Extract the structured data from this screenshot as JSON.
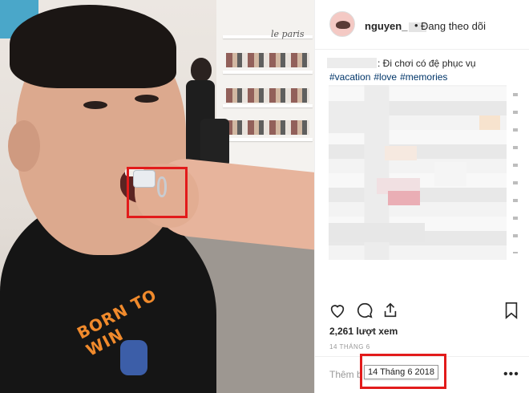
{
  "post": {
    "username": "nguyen_",
    "separator": "•",
    "follow_label": "Đang theo dõi",
    "caption_text": ": Đi chơi có đệ phục vụ",
    "hashtags": [
      "#vacation",
      "#love",
      "#memories"
    ],
    "views": "2,261 lượt xem",
    "date_small": "14 THÁNG 6",
    "comment_placeholder": "Thêm b",
    "date_tooltip": "14 Tháng 6 2018",
    "more_label": "•••"
  },
  "photo": {
    "store_sign": "le paris",
    "shirt_print": "BORN TO WIN"
  },
  "colors": {
    "highlight": "#e21b1b",
    "hashtag": "#003569",
    "text": "#262626",
    "muted": "#999999"
  },
  "icons": [
    "heart-icon",
    "comment-icon",
    "share-icon",
    "bookmark-icon",
    "more-options-icon"
  ]
}
